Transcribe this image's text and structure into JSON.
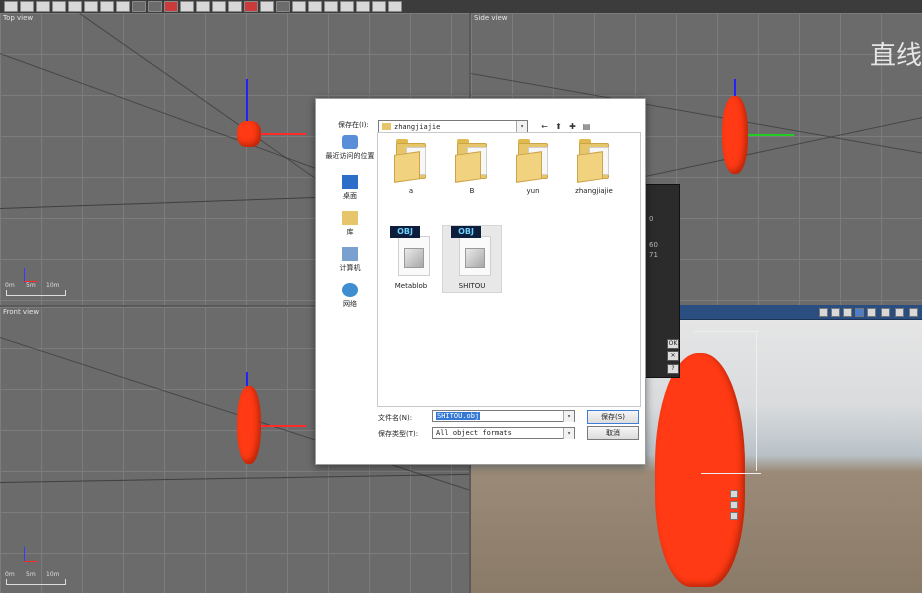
{
  "viewports": {
    "top": {
      "title": "Top view",
      "scale": [
        "0m",
        "5m",
        "10m"
      ]
    },
    "side": {
      "title": "Side view"
    },
    "front": {
      "title": "Front view",
      "scale": [
        "0m",
        "5m",
        "10m"
      ]
    },
    "perspective": {
      "title": ""
    }
  },
  "overlay_text": "直线",
  "palette": {
    "numbers": [
      "0",
      "60",
      "71"
    ],
    "buttons": [
      "OK",
      "✕",
      "?"
    ]
  },
  "dialog": {
    "save_in_label": "保存在(I):",
    "current_folder": "zhangjiajie",
    "places": [
      "最近访问的位置",
      "桌面",
      "库",
      "计算机",
      "网络"
    ],
    "files": [
      {
        "name": "a",
        "kind": "folder"
      },
      {
        "name": "B",
        "kind": "folder"
      },
      {
        "name": "yun",
        "kind": "folder"
      },
      {
        "name": "zhangjiajie",
        "kind": "folder"
      },
      {
        "name": "Metablob",
        "kind": "obj",
        "tag": "OBJ"
      },
      {
        "name": "SHITOU",
        "kind": "obj",
        "tag": "OBJ"
      }
    ],
    "filename_label": "文件名(N):",
    "filename_value": "SHITOU.obj",
    "filetype_label": "保存类型(T):",
    "filetype_value": "All object formats",
    "save_button": "保存(S)",
    "cancel_button": "取消"
  },
  "colors": {
    "stone": "#ff3a14",
    "selection": "#3378d4",
    "persp_bar": "#2a4e80"
  }
}
